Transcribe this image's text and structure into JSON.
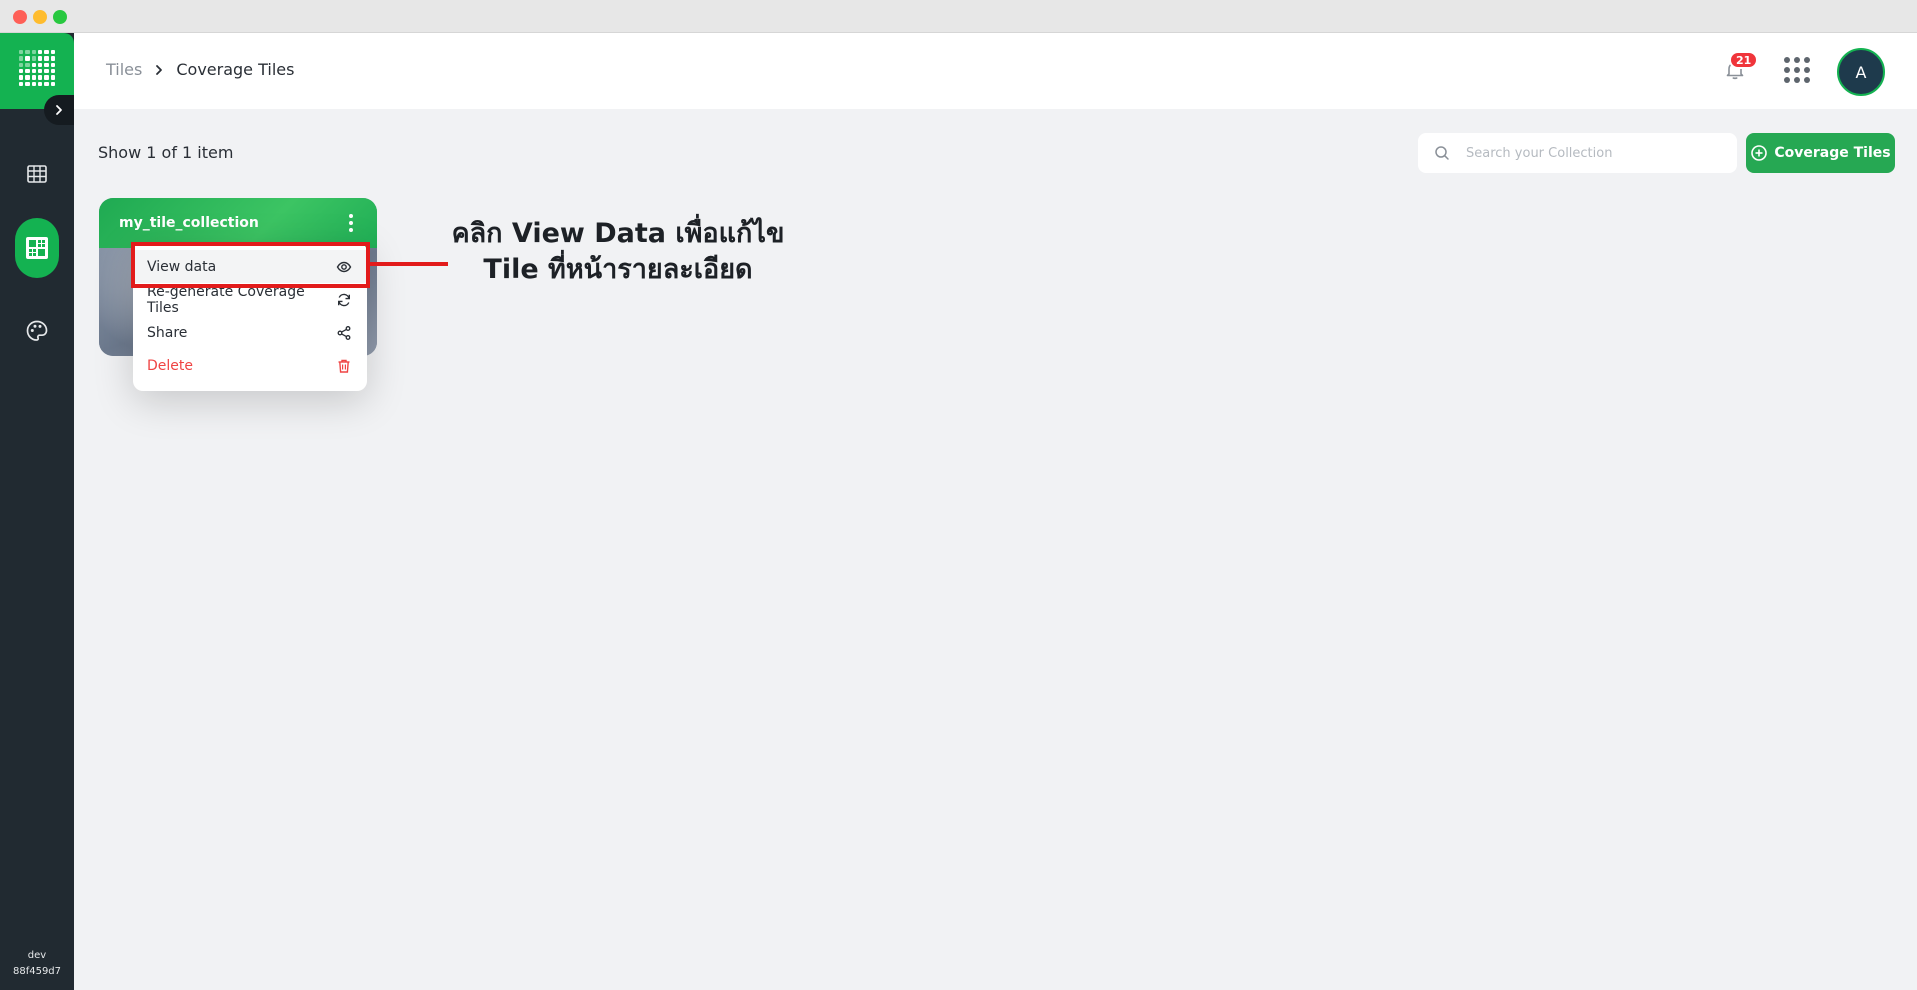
{
  "sidebar": {
    "footer_env": "dev",
    "footer_build": "88f459d7"
  },
  "breadcrumb": {
    "root": "Tiles",
    "current": "Coverage Tiles"
  },
  "header": {
    "notification_count": "21",
    "avatar_initial": "A"
  },
  "content": {
    "show_count": "Show 1 of 1 item",
    "search_placeholder": "Search your Collection",
    "add_button_label": "Coverage Tiles"
  },
  "card": {
    "title": "my_tile_collection"
  },
  "menu": {
    "items": [
      {
        "label": "View data",
        "icon": "eye-icon"
      },
      {
        "label": "Re-generate Coverage Tiles",
        "icon": "refresh-icon"
      },
      {
        "label": "Share",
        "icon": "share-icon"
      },
      {
        "label": "Delete",
        "icon": "trash-icon"
      }
    ]
  },
  "annotation": {
    "line1": "คลิก View Data เพื่อแก้ไข",
    "line2": "Tile ที่หน้ารายละเอียด"
  },
  "colors": {
    "brand_green": "#14b251",
    "sidebar_bg": "#212a31",
    "highlight_red": "#e21b1b",
    "danger": "#ef4444"
  }
}
